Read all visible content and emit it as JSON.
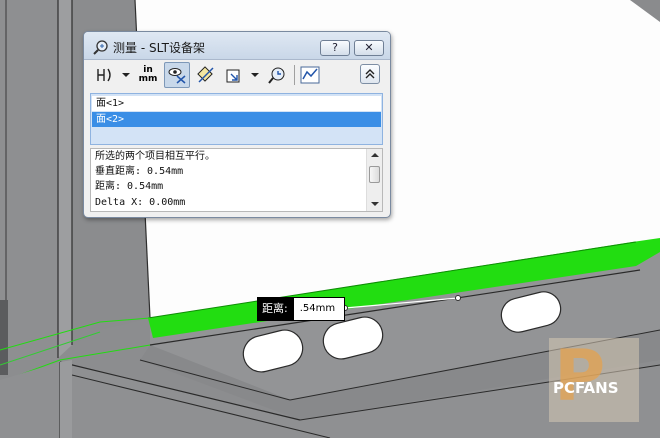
{
  "dialog": {
    "title": "测量 - SLT设备架",
    "help_label": "?",
    "close_label": "✕",
    "toolbar": {
      "units_top": "in",
      "units_bottom": "mm",
      "icons": [
        "arc-circle-icon",
        "units-precision-icon",
        "show-xyz-icon",
        "point-to-point-icon",
        "projection-icon",
        "measure-history-icon",
        "sensor-icon",
        "collapse-icon"
      ]
    },
    "selections": [
      "面<1>",
      "面<2>"
    ],
    "results": [
      "所选的两个项目相互平行。",
      "垂直距离: 0.54mm",
      "距离: 0.54mm",
      "Delta X: 0.00mm"
    ]
  },
  "callout": {
    "label": "距离:",
    "value": ".54mm"
  },
  "watermark": {
    "text": "PCFANS",
    "letter": "P"
  },
  "colors": {
    "highlight": "#22dd11",
    "titlebar": "#c9d7e8",
    "selection": "#3a8ee6"
  }
}
